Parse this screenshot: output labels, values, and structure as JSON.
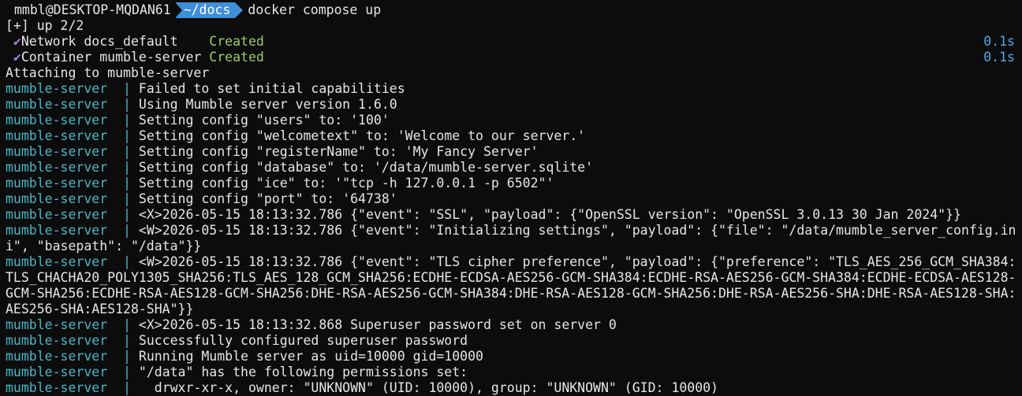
{
  "prompt": {
    "user_host": "mmbl@DESKTOP-MQDAN61",
    "path": "~/docs",
    "command": "docker compose up"
  },
  "progress_header": "[+] up 2/2",
  "resources": [
    {
      "label": "Network docs_default   ",
      "status": "Created",
      "time": "0.1s"
    },
    {
      "label": "Container mumble-server",
      "status": "Created",
      "time": "0.1s"
    }
  ],
  "attaching": "Attaching to mumble-server",
  "service_prefix": "mumble-server  | ",
  "log_lines": [
    "Failed to set initial capabilities",
    "Using Mumble server version 1.6.0",
    "Setting config \"users\" to: '100'",
    "Setting config \"welcometext\" to: 'Welcome to our server.'",
    "Setting config \"registerName\" to: 'My Fancy Server'",
    "Setting config \"database\" to: '/data/mumble-server.sqlite'",
    "Setting config \"ice\" to: '\"tcp -h 127.0.0.1 -p 6502\"'",
    "Setting config \"port\" to: '64738'",
    "<X>2026-05-15 18:13:32.786 {\"event\": \"SSL\", \"payload\": {\"OpenSSL version\": \"OpenSSL 3.0.13 30 Jan 2024\"}}",
    "<W>2026-05-15 18:13:32.786 {\"event\": \"Initializing settings\", \"payload\": {\"file\": \"/data/mumble_server_config.ini\", \"basepath\": \"/data\"}}",
    "<W>2026-05-15 18:13:32.786 {\"event\": \"TLS cipher preference\", \"payload\": {\"preference\": \"TLS_AES_256_GCM_SHA384:TLS_CHACHA20_POLY1305_SHA256:TLS_AES_128_GCM_SHA256:ECDHE-ECDSA-AES256-GCM-SHA384:ECDHE-RSA-AES256-GCM-SHA384:ECDHE-ECDSA-AES128-GCM-SHA256:ECDHE-RSA-AES128-GCM-SHA256:DHE-RSA-AES256-GCM-SHA384:DHE-RSA-AES128-GCM-SHA256:DHE-RSA-AES256-SHA:DHE-RSA-AES128-SHA:AES256-SHA:AES128-SHA\"}}",
    "<X>2026-05-15 18:13:32.868 Superuser password set on server 0",
    "Successfully configured superuser password",
    "Running Mumble server as uid=10000 gid=10000",
    "\"/data\" has the following permissions set:",
    "  drwxr-xr-x, owner: \"UNKNOWN\" (UID: 10000), group: \"UNKNOWN\" (GID: 10000)"
  ],
  "colors": {
    "background": "#0c0c0c",
    "path_segment": "#3f8fd8",
    "service_name": "#49b6c7",
    "created": "#9ccc65",
    "timing": "#4fa8e8",
    "checkmark": "#a178e8"
  }
}
